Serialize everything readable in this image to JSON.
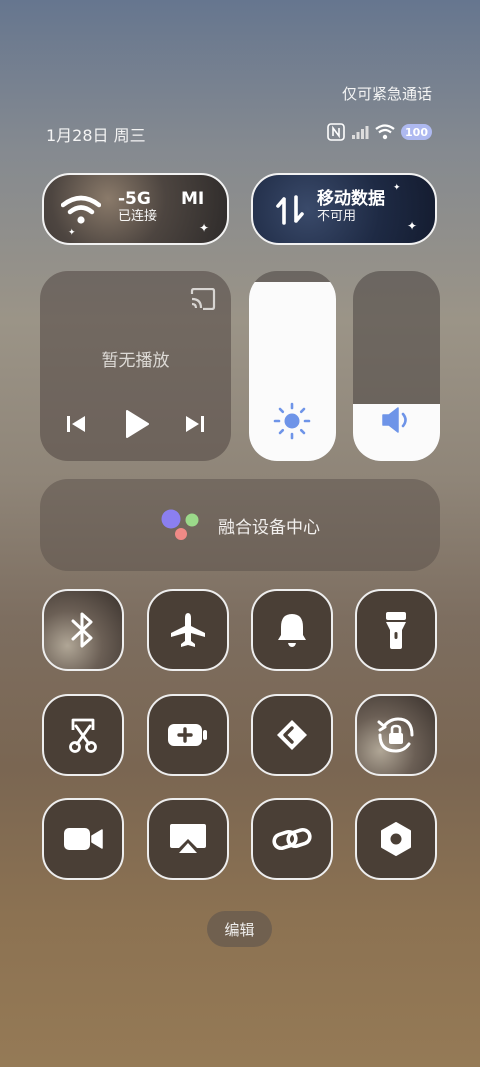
{
  "status": {
    "emergency": "仅可紧急通话",
    "date": "1月28日 周三",
    "battery": "100"
  },
  "tiles_top": {
    "wifi": {
      "title": "-5G",
      "title_right": "MI",
      "subtitle": "已连接"
    },
    "mobile_data": {
      "title": "移动数据",
      "subtitle": "不可用"
    }
  },
  "media": {
    "title": "暂无播放"
  },
  "sliders": {
    "brightness_level": 0.94,
    "volume_level": 0.3
  },
  "fusion": {
    "label": "融合设备中心"
  },
  "grid": [
    "bluetooth-icon",
    "airplane-icon",
    "bell-icon",
    "flashlight-icon",
    "screenshot-scissors-icon",
    "battery-saver-icon",
    "nearby-share-icon",
    "rotation-lock-icon",
    "video-camera-icon",
    "screen-cast-icon",
    "link-icon",
    "settings-hex-icon"
  ],
  "edit": {
    "label": "编辑"
  }
}
